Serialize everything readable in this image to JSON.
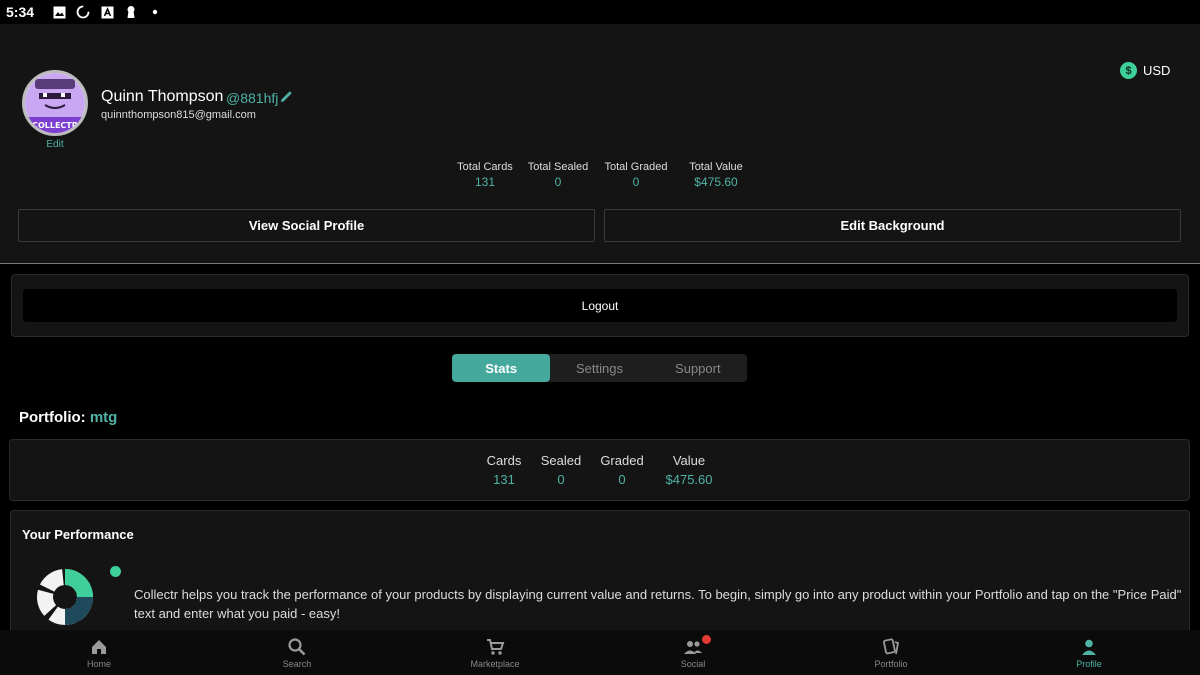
{
  "status_bar": {
    "time": "5:34"
  },
  "profile": {
    "name": "Quinn Thompson",
    "handle": "@881hfj",
    "email": "quinnthompson815@gmail.com",
    "avatar_edit_label": "Edit",
    "avatar_text": "COLLECTR"
  },
  "currency": {
    "symbol": "$",
    "code": "USD"
  },
  "totals": [
    {
      "label": "Total Cards",
      "value": "131"
    },
    {
      "label": "Total Sealed",
      "value": "0"
    },
    {
      "label": "Total Graded",
      "value": "0"
    },
    {
      "label": "Total Value",
      "value": "$475.60"
    }
  ],
  "buttons": {
    "view_social": "View Social Profile",
    "edit_background": "Edit Background",
    "logout": "Logout"
  },
  "tabs": [
    {
      "label": "Stats",
      "active": true
    },
    {
      "label": "Settings",
      "active": false
    },
    {
      "label": "Support",
      "active": false
    }
  ],
  "portfolio": {
    "label": "Portfolio:",
    "name": "mtg",
    "stats": [
      {
        "label": "Cards",
        "value": "131"
      },
      {
        "label": "Sealed",
        "value": "0"
      },
      {
        "label": "Graded",
        "value": "0"
      },
      {
        "label": "Value",
        "value": "$475.60"
      }
    ]
  },
  "performance": {
    "title": "Your Performance",
    "text": "Collectr helps you track the performance of your products by displaying current value and returns.  To begin, simply go into any product within your Portfolio and tap on the \"Price Paid\" text and enter what you paid - easy!"
  },
  "nav": [
    {
      "label": "Home",
      "icon": "home-icon"
    },
    {
      "label": "Search",
      "icon": "search-icon"
    },
    {
      "label": "Marketplace",
      "icon": "cart-icon"
    },
    {
      "label": "Social",
      "icon": "people-icon"
    },
    {
      "label": "Portfolio",
      "icon": "cards-icon"
    },
    {
      "label": "Profile",
      "icon": "person-icon"
    }
  ],
  "colors": {
    "accent": "#4fb3a6",
    "tab_active": "#45a89d",
    "notification": "#e53935"
  }
}
